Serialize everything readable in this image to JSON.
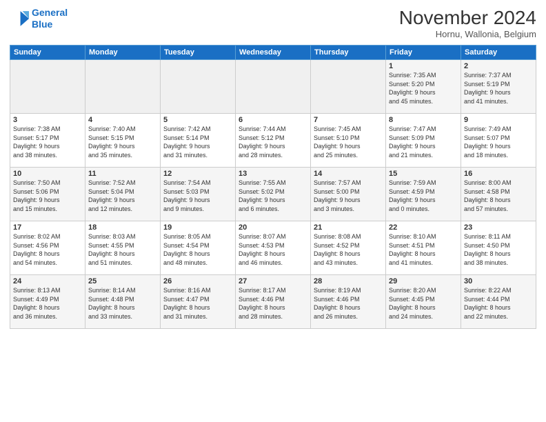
{
  "logo": {
    "line1": "General",
    "line2": "Blue"
  },
  "title": "November 2024",
  "location": "Hornu, Wallonia, Belgium",
  "days_header": [
    "Sunday",
    "Monday",
    "Tuesday",
    "Wednesday",
    "Thursday",
    "Friday",
    "Saturday"
  ],
  "weeks": [
    [
      {
        "day": "",
        "info": ""
      },
      {
        "day": "",
        "info": ""
      },
      {
        "day": "",
        "info": ""
      },
      {
        "day": "",
        "info": ""
      },
      {
        "day": "",
        "info": ""
      },
      {
        "day": "1",
        "info": "Sunrise: 7:35 AM\nSunset: 5:20 PM\nDaylight: 9 hours\nand 45 minutes."
      },
      {
        "day": "2",
        "info": "Sunrise: 7:37 AM\nSunset: 5:19 PM\nDaylight: 9 hours\nand 41 minutes."
      }
    ],
    [
      {
        "day": "3",
        "info": "Sunrise: 7:38 AM\nSunset: 5:17 PM\nDaylight: 9 hours\nand 38 minutes."
      },
      {
        "day": "4",
        "info": "Sunrise: 7:40 AM\nSunset: 5:15 PM\nDaylight: 9 hours\nand 35 minutes."
      },
      {
        "day": "5",
        "info": "Sunrise: 7:42 AM\nSunset: 5:14 PM\nDaylight: 9 hours\nand 31 minutes."
      },
      {
        "day": "6",
        "info": "Sunrise: 7:44 AM\nSunset: 5:12 PM\nDaylight: 9 hours\nand 28 minutes."
      },
      {
        "day": "7",
        "info": "Sunrise: 7:45 AM\nSunset: 5:10 PM\nDaylight: 9 hours\nand 25 minutes."
      },
      {
        "day": "8",
        "info": "Sunrise: 7:47 AM\nSunset: 5:09 PM\nDaylight: 9 hours\nand 21 minutes."
      },
      {
        "day": "9",
        "info": "Sunrise: 7:49 AM\nSunset: 5:07 PM\nDaylight: 9 hours\nand 18 minutes."
      }
    ],
    [
      {
        "day": "10",
        "info": "Sunrise: 7:50 AM\nSunset: 5:06 PM\nDaylight: 9 hours\nand 15 minutes."
      },
      {
        "day": "11",
        "info": "Sunrise: 7:52 AM\nSunset: 5:04 PM\nDaylight: 9 hours\nand 12 minutes."
      },
      {
        "day": "12",
        "info": "Sunrise: 7:54 AM\nSunset: 5:03 PM\nDaylight: 9 hours\nand 9 minutes."
      },
      {
        "day": "13",
        "info": "Sunrise: 7:55 AM\nSunset: 5:02 PM\nDaylight: 9 hours\nand 6 minutes."
      },
      {
        "day": "14",
        "info": "Sunrise: 7:57 AM\nSunset: 5:00 PM\nDaylight: 9 hours\nand 3 minutes."
      },
      {
        "day": "15",
        "info": "Sunrise: 7:59 AM\nSunset: 4:59 PM\nDaylight: 9 hours\nand 0 minutes."
      },
      {
        "day": "16",
        "info": "Sunrise: 8:00 AM\nSunset: 4:58 PM\nDaylight: 8 hours\nand 57 minutes."
      }
    ],
    [
      {
        "day": "17",
        "info": "Sunrise: 8:02 AM\nSunset: 4:56 PM\nDaylight: 8 hours\nand 54 minutes."
      },
      {
        "day": "18",
        "info": "Sunrise: 8:03 AM\nSunset: 4:55 PM\nDaylight: 8 hours\nand 51 minutes."
      },
      {
        "day": "19",
        "info": "Sunrise: 8:05 AM\nSunset: 4:54 PM\nDaylight: 8 hours\nand 48 minutes."
      },
      {
        "day": "20",
        "info": "Sunrise: 8:07 AM\nSunset: 4:53 PM\nDaylight: 8 hours\nand 46 minutes."
      },
      {
        "day": "21",
        "info": "Sunrise: 8:08 AM\nSunset: 4:52 PM\nDaylight: 8 hours\nand 43 minutes."
      },
      {
        "day": "22",
        "info": "Sunrise: 8:10 AM\nSunset: 4:51 PM\nDaylight: 8 hours\nand 41 minutes."
      },
      {
        "day": "23",
        "info": "Sunrise: 8:11 AM\nSunset: 4:50 PM\nDaylight: 8 hours\nand 38 minutes."
      }
    ],
    [
      {
        "day": "24",
        "info": "Sunrise: 8:13 AM\nSunset: 4:49 PM\nDaylight: 8 hours\nand 36 minutes."
      },
      {
        "day": "25",
        "info": "Sunrise: 8:14 AM\nSunset: 4:48 PM\nDaylight: 8 hours\nand 33 minutes."
      },
      {
        "day": "26",
        "info": "Sunrise: 8:16 AM\nSunset: 4:47 PM\nDaylight: 8 hours\nand 31 minutes."
      },
      {
        "day": "27",
        "info": "Sunrise: 8:17 AM\nSunset: 4:46 PM\nDaylight: 8 hours\nand 28 minutes."
      },
      {
        "day": "28",
        "info": "Sunrise: 8:19 AM\nSunset: 4:46 PM\nDaylight: 8 hours\nand 26 minutes."
      },
      {
        "day": "29",
        "info": "Sunrise: 8:20 AM\nSunset: 4:45 PM\nDaylight: 8 hours\nand 24 minutes."
      },
      {
        "day": "30",
        "info": "Sunrise: 8:22 AM\nSunset: 4:44 PM\nDaylight: 8 hours\nand 22 minutes."
      }
    ]
  ]
}
